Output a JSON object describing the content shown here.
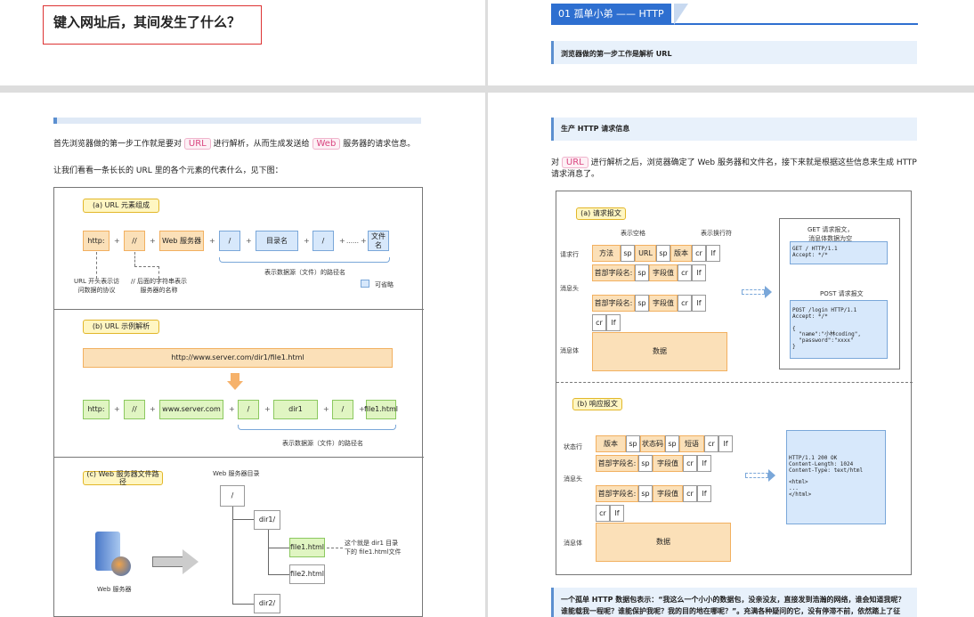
{
  "page_title": "键入网址后，其间发生了什么？",
  "intro": {
    "line1_a": "首先浏览器做的第一步工作就是要对",
    "url_tag": "URL",
    "line1_b": "进行解析，从而生成发送给",
    "web_tag": "Web",
    "line1_c": "服务器的请求信息。",
    "line2": "让我们看看一条长长的 URL 里的各个元素的代表什么，见下图："
  },
  "sec_a": {
    "label": "(a) URL 元素组成",
    "http": "http:",
    "slashes": "//",
    "web": "Web 服务器",
    "slash": "/",
    "dir": "目录名",
    "dots": "……",
    "file": "文件名",
    "note1": "URL 开头表示访\n问数据的协议",
    "note2": "// 后面的字符串表示\n服务器的名称",
    "path_note": "表示数据源（文件）的路径名",
    "optional": "可省略",
    "plus": "+"
  },
  "sec_b": {
    "label": "(b) URL 示例解析",
    "url": "http://www.server.com/dir1/file1.html",
    "http": "http:",
    "slashes": "//",
    "server": "www.server.com",
    "slash": "/",
    "dir": "dir1",
    "file": "file1.html",
    "path_note": "表示数据源（文件）的路径名"
  },
  "sec_c": {
    "label": "(c) Web 服务器文件路径",
    "root_title": "Web 服务器目录",
    "root": "/",
    "dir1": "dir1/",
    "file1": "file1.html",
    "file2": "file2.html",
    "dir2": "dir2/",
    "file_note": "这个就是 dir1 目录\n下的 file1.html文件",
    "server_label": "Web 服务器"
  },
  "right": {
    "title": "01 孤单小弟 —— HTTP",
    "step1": "浏览器做的第一步工作是解析 URL",
    "step2": "生产 HTTP 请求信息",
    "para_a": "对",
    "url_tag": "URL",
    "para_b": "进行解析之后，浏览器确定了 Web 服务器和文件名，接下来就是根据这些信息来生成 HTTP",
    "para_c": "请求消息了。",
    "req": {
      "label": "(a) 请求报文",
      "sp_note": "表示空格",
      "crlf_note": "表示换行符",
      "req_line": "请求行",
      "header": "消息头",
      "body_lbl": "消息体",
      "method": "方法",
      "sp": "sp",
      "url": "URL",
      "ver": "版本",
      "cr": "cr",
      "lf": "lf",
      "field": "首部字段名:",
      "value": "字段值",
      "data": "数据",
      "get_title": "GET 请求报文，\n消息体数据为空",
      "get_body": "GET / HTTP/1.1\nAccept: */*",
      "post_title": "POST 请求报文",
      "post_body": "POST /login HTTP/1.1\nAccept: */*\n\n{\n  \"name\":\"小林coding\",\n  \"password\":\"xxxx\"\n}"
    },
    "resp": {
      "label": "(b) 响应报文",
      "status_line": "状态行",
      "header": "消息头",
      "body_lbl": "消息体",
      "ver": "版本",
      "sp": "sp",
      "code": "状态码",
      "phrase": "短语",
      "cr": "cr",
      "lf": "lf",
      "field": "首部字段名:",
      "value": "字段值",
      "data": "数据",
      "sample": "HTTP/1.1 200 OK\nContent-Length: 1024\nContent-Type: text/html\n\n<html>\n...\n</html>"
    },
    "bottom1": "一个孤单 HTTP 数据包表示：“我这么一个小小的数据包，没亲没友，直接发到浩瀚的网络，谁会知道我呢？",
    "bottom2": "谁能载我一程呢？谁能保护我呢？我的目的地在哪呢？”。充满各种疑问的它，没有停滞不前，依然踏上了征"
  },
  "colors": {
    "accent": "#2e6fd0",
    "tag_pink": "#d9447f",
    "orange": "#fbe0b8",
    "green": "#e0f5c2",
    "blue": "#d7e8fb"
  }
}
